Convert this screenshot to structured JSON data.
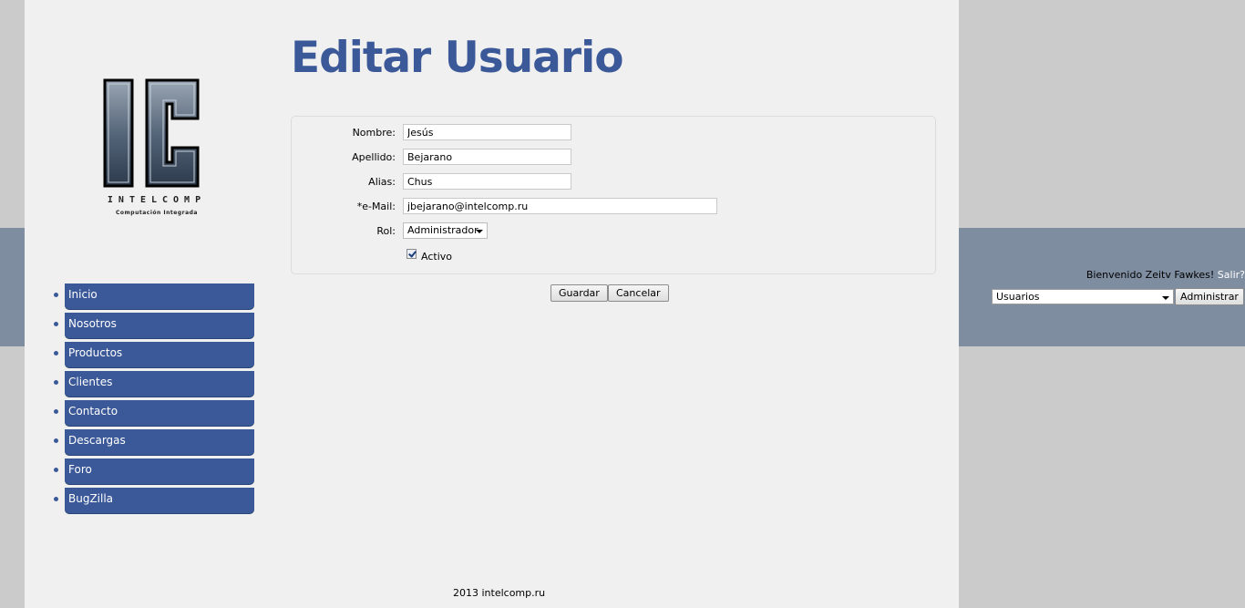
{
  "logo": {
    "letters": "IC",
    "name": "INTELCOMP",
    "tagline": "Computación Integrada"
  },
  "page_title": "Editar Usuario",
  "nav": {
    "items": [
      {
        "label": "Inicio"
      },
      {
        "label": "Nosotros"
      },
      {
        "label": "Productos"
      },
      {
        "label": "Clientes"
      },
      {
        "label": "Contacto"
      },
      {
        "label": "Descargas"
      },
      {
        "label": "Foro"
      },
      {
        "label": "BugZilla"
      }
    ]
  },
  "form": {
    "nombre_label": "Nombre:",
    "nombre_value": "Jesús",
    "apellido_label": "Apellido:",
    "apellido_value": "Bejarano",
    "alias_label": "Alias:",
    "alias_value": "Chus",
    "email_label": "*e-Mail:",
    "email_value": "jbejarano@intelcomp.ru",
    "rol_label": "Rol:",
    "rol_value": "Administrador",
    "activo_label": "Activo",
    "activo_checked": true
  },
  "actions": {
    "save_label": "Guardar",
    "cancel_label": "Cancelar"
  },
  "footer": "2013 intelcomp.ru",
  "admin": {
    "welcome_text": "Bienvenido Zeitv Fawkes!",
    "logout_link": "Salir?",
    "section_value": "Usuarios",
    "admin_button": "Administrar"
  },
  "colors": {
    "brand_blue": "#3b5998",
    "band": "#7f8da0",
    "page_bg": "#f0f0f0",
    "outer_bg": "#cbcbcb"
  }
}
